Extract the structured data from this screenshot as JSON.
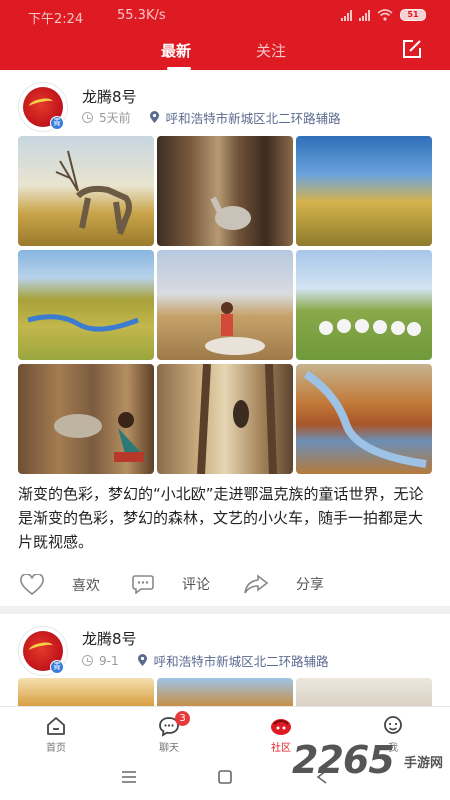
{
  "status_bar": {
    "time": "下午2:24",
    "speed": "55.3K/s",
    "battery": "51"
  },
  "header": {
    "tabs": [
      {
        "label": "最新",
        "active": true
      },
      {
        "label": "关注",
        "active": false
      }
    ],
    "edit_icon": "edit-square-icon"
  },
  "posts": [
    {
      "author": "龙腾8号",
      "verified_badge": "青",
      "time": "5天前",
      "location": "呼和浩特市新城区北二环路辅路",
      "text": "渐变的色彩，梦幻的“小北欧”走进鄂温克族的童话世界，无论是渐变的色彩，梦幻的森林，文艺的小火车，随手一拍都是大片既视感。",
      "photos": [
        "reindeer-grassland",
        "reindeer-forest",
        "autumn-hills",
        "river-meadow",
        "girl-with-reindeer",
        "yurt-camp",
        "woman-feeding-reindeer",
        "reindeer-birch-forest",
        "autumn-river"
      ],
      "actions": {
        "like": "喜欢",
        "comment": "评论",
        "share": "分享"
      }
    },
    {
      "author": "龙腾8号",
      "verified_badge": "青",
      "time": "9-1",
      "location": "呼和浩特市新城区北二环路辅路",
      "thumbnails": [
        "calligraphy-sign",
        "autumn-tree",
        "ink-calligraphy"
      ]
    }
  ],
  "bottom_nav": {
    "items": [
      {
        "label": "首页",
        "icon": "home-icon",
        "active": false
      },
      {
        "label": "聊天",
        "icon": "chat-icon",
        "active": false,
        "badge": "3"
      },
      {
        "label": "社区",
        "icon": "community-icon",
        "active": true
      },
      {
        "label": "我",
        "icon": "profile-icon",
        "active": false
      }
    ]
  },
  "watermark": {
    "number": "2265",
    "text": "手游网"
  },
  "colors": {
    "brand_red": "#de1b22",
    "location_blue": "#5b6a8f",
    "badge_red": "#e83a3a"
  }
}
